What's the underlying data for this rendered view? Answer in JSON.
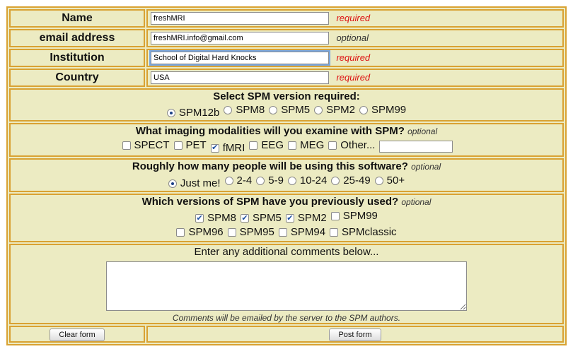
{
  "fields": [
    {
      "label": "Name",
      "value": "freshMRI",
      "status": "required"
    },
    {
      "label": "email address",
      "value": "freshMRI.info@gmail.com",
      "status": "optional"
    },
    {
      "label": "Institution",
      "value": "School of Digital Hard Knocks",
      "status": "required"
    },
    {
      "label": "Country",
      "value": "USA",
      "status": "required"
    }
  ],
  "spm_version": {
    "question": "Select SPM version required:",
    "options": [
      "SPM12b",
      "SPM8",
      "SPM5",
      "SPM2",
      "SPM99"
    ],
    "selected": "SPM12b"
  },
  "modalities": {
    "question": "What imaging modalities will you examine with SPM?",
    "note": "optional",
    "options": [
      {
        "label": "SPECT",
        "checked": false
      },
      {
        "label": "PET",
        "checked": false
      },
      {
        "label": "fMRI",
        "checked": true
      },
      {
        "label": "EEG",
        "checked": false
      },
      {
        "label": "MEG",
        "checked": false
      },
      {
        "label": "Other...",
        "checked": false
      }
    ],
    "other_value": ""
  },
  "users": {
    "question": "Roughly how many people will be using this software?",
    "note": "optional",
    "options": [
      "Just me!",
      "2-4",
      "5-9",
      "10-24",
      "25-49",
      "50+"
    ],
    "selected": "Just me!"
  },
  "previous": {
    "question": "Which versions of SPM have you previously used?",
    "note": "optional",
    "row1": [
      {
        "label": "SPM8",
        "checked": true
      },
      {
        "label": "SPM5",
        "checked": true
      },
      {
        "label": "SPM2",
        "checked": true
      },
      {
        "label": "SPM99",
        "checked": false
      }
    ],
    "row2": [
      {
        "label": "SPM96",
        "checked": false
      },
      {
        "label": "SPM95",
        "checked": false
      },
      {
        "label": "SPM94",
        "checked": false
      },
      {
        "label": "SPMclassic",
        "checked": false
      }
    ]
  },
  "comments": {
    "heading": "Enter any additional comments below...",
    "value": "",
    "note": "Comments will be emailed by the server to the SPM authors."
  },
  "buttons": {
    "clear": "Clear form",
    "post": "Post form"
  },
  "colors": {
    "background": "#ecebc2",
    "border": "#d9a233",
    "required": "#dd1111"
  }
}
